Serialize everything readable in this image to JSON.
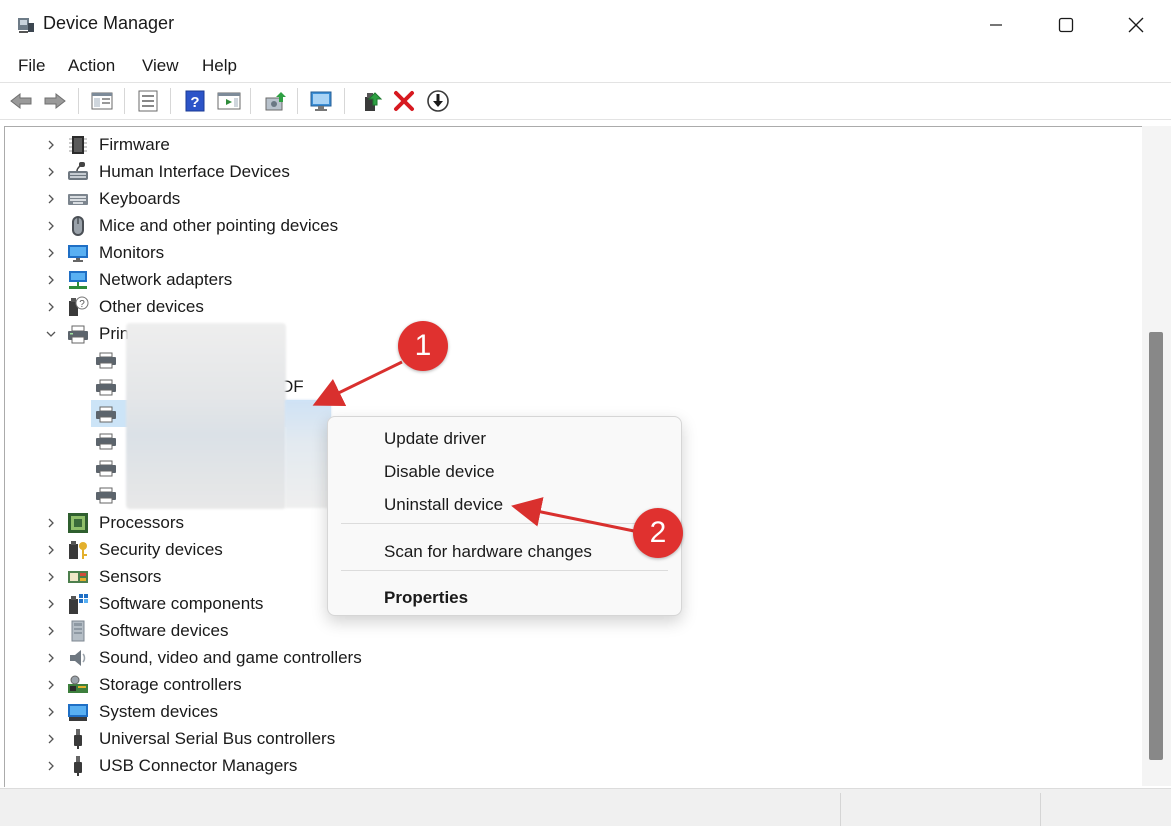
{
  "window": {
    "title": "Device Manager"
  },
  "menu": [
    "File",
    "Action",
    "View",
    "Help"
  ],
  "toolbar": [
    {
      "icon": "back-arrow-icon"
    },
    {
      "icon": "forward-arrow-icon"
    },
    {
      "icon": "show-hide-console-tree-icon"
    },
    {
      "icon": "properties-icon"
    },
    {
      "icon": "help-icon"
    },
    {
      "icon": "show-action-pane-icon"
    },
    {
      "icon": "update-driver-icon"
    },
    {
      "icon": "scan-hardware-icon"
    },
    {
      "icon": "enable-device-icon"
    },
    {
      "icon": "uninstall-device-icon"
    },
    {
      "icon": "disable-device-icon"
    }
  ],
  "tree": {
    "top_items": [
      {
        "label": "Firmware",
        "icon": "firmware-icon"
      },
      {
        "label": "Human Interface Devices",
        "icon": "hid-icon"
      },
      {
        "label": "Keyboards",
        "icon": "keyboard-icon"
      },
      {
        "label": "Mice and other pointing devices",
        "icon": "mouse-icon"
      },
      {
        "label": "Monitors",
        "icon": "monitor-icon"
      },
      {
        "label": "Network adapters",
        "icon": "network-adapter-icon"
      },
      {
        "label": "Other devices",
        "icon": "other-devices-icon"
      }
    ],
    "expanded": {
      "label": "Print",
      "icon": "printer-icon",
      "visible_child_fragment": "DF"
    },
    "bottom_items": [
      {
        "label": "Processors",
        "icon": "processor-icon"
      },
      {
        "label": "Security devices",
        "icon": "security-key-icon"
      },
      {
        "label": "Sensors",
        "icon": "sensor-icon"
      },
      {
        "label": "Software components",
        "icon": "software-component-icon"
      },
      {
        "label": "Software devices",
        "icon": "software-device-icon"
      },
      {
        "label": "Sound, video and game controllers",
        "icon": "speaker-icon"
      },
      {
        "label": "Storage controllers",
        "icon": "storage-controller-icon"
      },
      {
        "label": "System devices",
        "icon": "system-device-icon"
      },
      {
        "label": "Universal Serial Bus controllers",
        "icon": "usb-icon"
      },
      {
        "label": "USB Connector Managers",
        "icon": "usb-icon"
      }
    ]
  },
  "context_menu": {
    "items": [
      "Update driver",
      "Disable device",
      "Uninstall device"
    ],
    "scan": "Scan for hardware changes",
    "properties": "Properties"
  },
  "annotations": [
    "1",
    "2"
  ],
  "colors": {
    "badge": "#e0312f",
    "arrow": "#d9302e",
    "selection": "#cce4f7"
  }
}
